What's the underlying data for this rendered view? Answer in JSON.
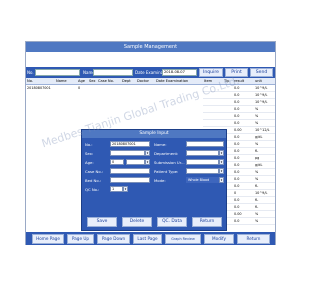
{
  "window": {
    "title": "Sample Management"
  },
  "toolbar": {
    "no_label": "No.",
    "name_label": "Name",
    "date_label": "Date Examination",
    "date_value": "2018-08-07",
    "inquire_label": "Inquire",
    "print_label": "Print",
    "send_label": "Send"
  },
  "columns": {
    "no": "No.",
    "name": "Name",
    "age": "Age",
    "sex": "Sex",
    "case_no": "Case No.",
    "dept": "Dept",
    "doctor": "Doctor",
    "date_exam": "Date Examination",
    "item": "Item",
    "tip": "Tip",
    "result": "result",
    "unit": "unit"
  },
  "sample_row": {
    "no": "20180807001",
    "age": "0"
  },
  "results": [
    {
      "item": "",
      "tip": "",
      "result": "0.0",
      "unit": "10^9/L"
    },
    {
      "item": "",
      "tip": "",
      "result": "0.0",
      "unit": "10^9/L"
    },
    {
      "item": "",
      "tip": "",
      "result": "0.0",
      "unit": "10^9/L"
    },
    {
      "item": "",
      "tip": "",
      "result": "0.0",
      "unit": "%"
    },
    {
      "item": "",
      "tip": "",
      "result": "0.0",
      "unit": "%"
    },
    {
      "item": "",
      "tip": "",
      "result": "0.0",
      "unit": "%"
    },
    {
      "item": "",
      "tip": "",
      "result": "0.00",
      "unit": "10^12/L"
    },
    {
      "item": "",
      "tip": "",
      "result": "0.0",
      "unit": "g/dL"
    },
    {
      "item": "",
      "tip": "",
      "result": "0.0",
      "unit": "%"
    },
    {
      "item": "",
      "tip": "",
      "result": "0.0",
      "unit": "fL"
    },
    {
      "item": "",
      "tip": "",
      "result": "0.0",
      "unit": "pg"
    },
    {
      "item": "",
      "tip": "",
      "result": "0.0",
      "unit": "g/dL"
    },
    {
      "item": "",
      "tip": "",
      "result": "0.0",
      "unit": "%"
    },
    {
      "item": "RDW-CV",
      "tip": "L",
      "result": "0.0",
      "unit": "%"
    },
    {
      "item": "RDW-SD",
      "tip": "L",
      "result": "0.0",
      "unit": "fL"
    },
    {
      "item": "PLT",
      "tip": "L",
      "result": "0",
      "unit": "10^9/L"
    },
    {
      "item": "PDW",
      "tip": "L",
      "result": "0.0",
      "unit": "fL"
    },
    {
      "item": "MPV",
      "tip": "L",
      "result": "0.0",
      "unit": "fL"
    },
    {
      "item": "PCT",
      "tip": "L",
      "result": "0.00",
      "unit": "%"
    },
    {
      "item": "P-LCR",
      "tip": "L",
      "result": "0.0",
      "unit": "%"
    }
  ],
  "modal": {
    "title": "Sample Input",
    "no_label": "No.:",
    "no_value": "20180807001",
    "name_label": "Name:",
    "sex_label": "Sex:",
    "department_label": "Department:",
    "age_label": "Age:",
    "age_value": "0",
    "admission_label": "Submission Ur...",
    "case_no_label": "Case No.:",
    "patient_type_label": "Patient Type:",
    "bed_no_label": "Bed No.:",
    "mode_label": "Mode:",
    "mode_value": "Whole Blood",
    "qc_label": "QC No.:",
    "qc_value": "1",
    "save_label": "Save",
    "delete_label": "Delete",
    "qc_data_label": "QC. Data",
    "return_label": "Return"
  },
  "bottom": {
    "home_label": "Home Page",
    "page_up_label": "Page Up",
    "page_down_label": "Page Down",
    "last_page_label": "Last Page",
    "graph_review_label": "Graph Review",
    "modify_label": "Modify",
    "return_label": "Return"
  },
  "watermark": "Medbes Tianjin Global Trading Co.Ltd."
}
